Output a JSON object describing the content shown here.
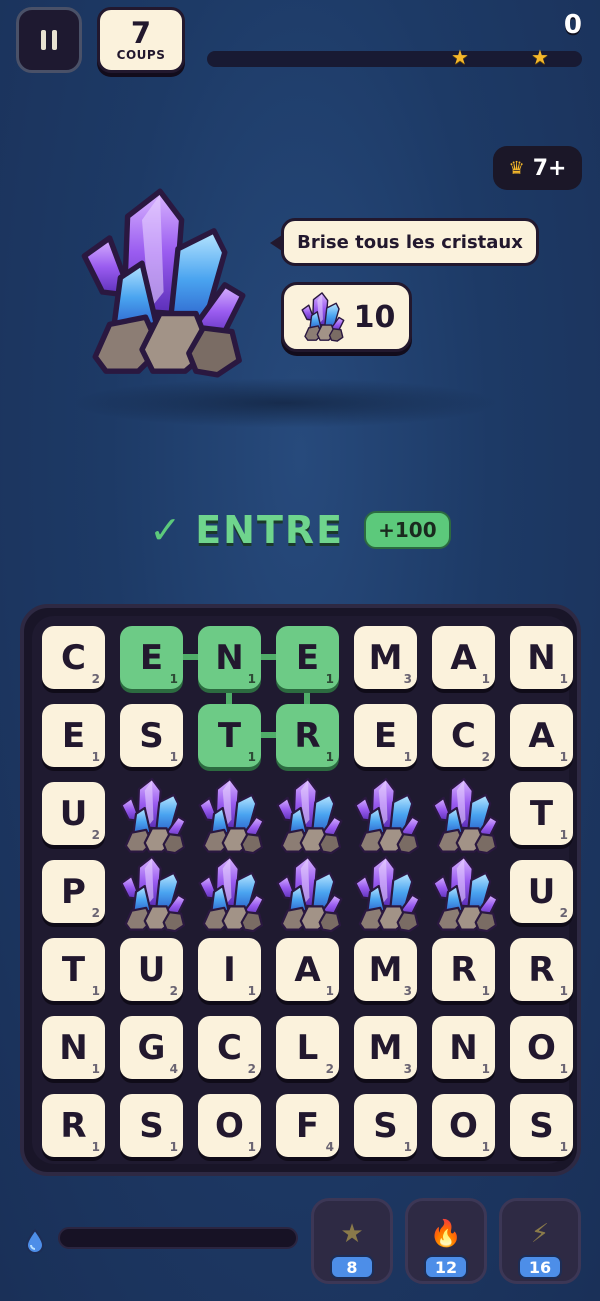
{
  "header": {
    "moves": "7",
    "moves_label": "COUPS",
    "score": "0",
    "progress": 0,
    "stars": [
      "star-icon",
      "star-icon"
    ],
    "rank": "7+",
    "rank_icon": "crown-icon"
  },
  "goal": {
    "text": "Brise tous les cristaux",
    "count": "10",
    "icon": "crystal-icon"
  },
  "feedback": {
    "check": "✓",
    "word": "ENTRE",
    "points": "+100"
  },
  "board": {
    "rows": [
      [
        {
          "l": "C",
          "p": "2"
        },
        {
          "l": "E",
          "p": "1",
          "sel": true
        },
        {
          "l": "N",
          "p": "1",
          "sel": true
        },
        {
          "l": "E",
          "p": "1",
          "sel": true
        },
        {
          "l": "M",
          "p": "3"
        },
        {
          "l": "A",
          "p": "1"
        },
        {
          "l": "N",
          "p": "1"
        }
      ],
      [
        {
          "l": "E",
          "p": "1"
        },
        {
          "l": "S",
          "p": "1"
        },
        {
          "l": "T",
          "p": "1",
          "sel": true
        },
        {
          "l": "R",
          "p": "1",
          "sel": true
        },
        {
          "l": "E",
          "p": "1"
        },
        {
          "l": "C",
          "p": "2"
        },
        {
          "l": "A",
          "p": "1"
        }
      ],
      [
        {
          "l": "U",
          "p": "2"
        },
        {
          "crystal": true
        },
        {
          "crystal": true
        },
        {
          "crystal": true
        },
        {
          "crystal": true
        },
        {
          "crystal": true
        },
        {
          "l": "T",
          "p": "1"
        }
      ],
      [
        {
          "l": "P",
          "p": "2"
        },
        {
          "crystal": true
        },
        {
          "crystal": true
        },
        {
          "crystal": true
        },
        {
          "crystal": true
        },
        {
          "crystal": true
        },
        {
          "l": "U",
          "p": "2"
        }
      ],
      [
        {
          "l": "T",
          "p": "1"
        },
        {
          "l": "U",
          "p": "2"
        },
        {
          "l": "I",
          "p": "1"
        },
        {
          "l": "A",
          "p": "1"
        },
        {
          "l": "M",
          "p": "3"
        },
        {
          "l": "R",
          "p": "1"
        },
        {
          "l": "R",
          "p": "1"
        }
      ],
      [
        {
          "l": "N",
          "p": "1"
        },
        {
          "l": "G",
          "p": "4"
        },
        {
          "l": "C",
          "p": "2"
        },
        {
          "l": "L",
          "p": "2"
        },
        {
          "l": "M",
          "p": "3"
        },
        {
          "l": "N",
          "p": "1"
        },
        {
          "l": "O",
          "p": "1"
        }
      ],
      [
        {
          "l": "R",
          "p": "1"
        },
        {
          "l": "S",
          "p": "1"
        },
        {
          "l": "O",
          "p": "1"
        },
        {
          "l": "F",
          "p": "4"
        },
        {
          "l": "S",
          "p": "1"
        },
        {
          "l": "O",
          "p": "1"
        },
        {
          "l": "S",
          "p": "1"
        }
      ]
    ]
  },
  "power": {
    "meter_icon": "water-drop-icon",
    "meter_level": 0,
    "boosters": [
      {
        "name": "star-booster",
        "icon": "star-icon",
        "glyph": "★",
        "color": "#8a7a4a",
        "count": "8"
      },
      {
        "name": "fire-booster",
        "icon": "flame-icon",
        "glyph": "🔥",
        "color": "#c0502a",
        "count": "12"
      },
      {
        "name": "lightning-booster",
        "icon": "lightning-icon",
        "glyph": "⚡",
        "color": "#8a7a4a",
        "count": "16"
      }
    ]
  },
  "colors": {
    "accent_green": "#6dcb86",
    "tile": "#fbf2dc",
    "gold": "#f5b82b",
    "count_badge": "#4d8ee8"
  }
}
